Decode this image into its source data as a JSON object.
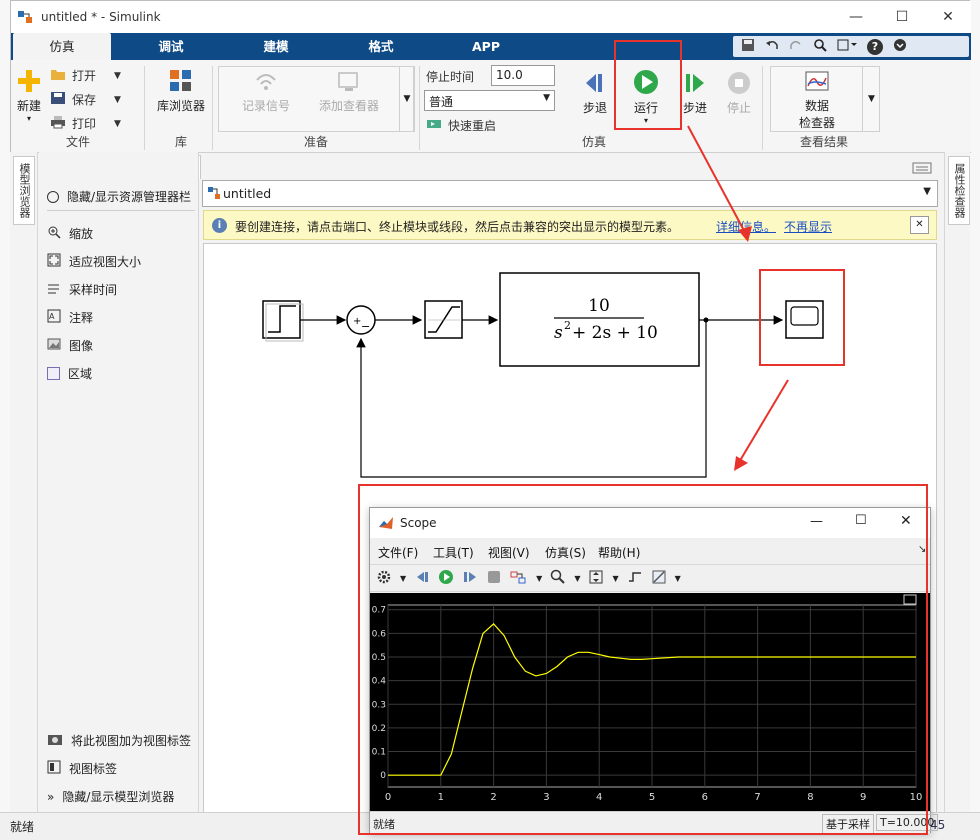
{
  "window": {
    "title": "untitled * - Simulink",
    "minimize": "—",
    "maximize": "☐",
    "close": "✕"
  },
  "tabs": [
    "仿真",
    "调试",
    "建模",
    "格式",
    "APP"
  ],
  "quick_access": {
    "help": "?"
  },
  "ribbon": {
    "new_label": "新建",
    "open_label": "打开",
    "save_label": "保存",
    "print_label": "打印",
    "file_section": "文件",
    "library_browser": "库浏览器",
    "library_section": "库",
    "log_signals": "记录信号",
    "add_viewer": "添加查看器",
    "prepare_section": "准备",
    "stop_time_label": "停止时间",
    "stop_time_value": "10.0",
    "mode_value": "普通",
    "fast_restart": "快速重启",
    "step_back": "步退",
    "run": "运行",
    "step_forward": "步进",
    "stop": "停止",
    "simulate_section": "仿真",
    "data_inspector_line1": "数据",
    "data_inspector_line2": "检查器",
    "review_section": "查看结果"
  },
  "left_strip": {
    "model_browser": "模型浏览器"
  },
  "right_strip": {
    "property_inspector": "属性检查器"
  },
  "nav": {
    "tab": "untitled"
  },
  "panel": {
    "toggle_explorer": "隐藏/显示资源管理器栏",
    "items": [
      "缩放",
      "适应视图大小",
      "采样时间",
      "注释",
      "图像",
      "区域"
    ],
    "add_view_tab": "将此视图加为视图标签",
    "view_tab": "视图标签",
    "toggle_model_browser": "隐藏/显示模型浏览器"
  },
  "address": {
    "path": "untitled"
  },
  "infobar": {
    "message": "要创建连接，请点击端口、终止模块或线段，然后点击兼容的突出显示的模型元素。",
    "details_link": "详细信息。",
    "dismiss_link": "不再显示",
    "close": "✕"
  },
  "diagram": {
    "tf_num": "10",
    "tf_den_s2": "s",
    "tf_den_exp": "2",
    "tf_den_rest": " + 2s + 10",
    "sum_plus": "+",
    "sum_minus": "−"
  },
  "status": {
    "left": "就绪",
    "right_partial": "45"
  },
  "scope": {
    "title": "Scope",
    "menus": [
      "文件(F)",
      "工具(T)",
      "视图(V)",
      "仿真(S)",
      "帮助(H)"
    ],
    "status_left": "就绪",
    "sample_mode": "基于采样",
    "time": "T=10.000"
  },
  "colors": {
    "tab_bar": "#0d4a86",
    "scope_bg": "#000000",
    "scope_trace": "#ffff00",
    "highlight": "#e8322c",
    "run_green": "#2ea84a"
  },
  "chart_data": {
    "type": "line",
    "x": [
      0,
      0.5,
      1.0,
      1.2,
      1.4,
      1.6,
      1.8,
      2.0,
      2.2,
      2.4,
      2.6,
      2.8,
      3.0,
      3.2,
      3.4,
      3.6,
      3.8,
      4.0,
      4.2,
      4.4,
      4.6,
      4.8,
      5.0,
      5.5,
      6.0,
      7.0,
      8.0,
      9.0,
      10.0
    ],
    "y": [
      0,
      0,
      0,
      0.09,
      0.27,
      0.45,
      0.6,
      0.64,
      0.59,
      0.5,
      0.44,
      0.42,
      0.43,
      0.46,
      0.5,
      0.52,
      0.52,
      0.51,
      0.5,
      0.495,
      0.49,
      0.49,
      0.493,
      0.5,
      0.5,
      0.5,
      0.5,
      0.5,
      0.5
    ],
    "xlim": [
      0,
      10
    ],
    "ylim": [
      -0.05,
      0.72
    ],
    "x_ticks": [
      "0",
      "1",
      "2",
      "3",
      "4",
      "5",
      "6",
      "7",
      "8",
      "9",
      "10"
    ],
    "y_ticks": [
      "0",
      "0.1",
      "0.2",
      "0.3",
      "0.4",
      "0.5",
      "0.6",
      "0.7"
    ],
    "grid": true,
    "title": "",
    "xlabel": "",
    "ylabel": ""
  }
}
